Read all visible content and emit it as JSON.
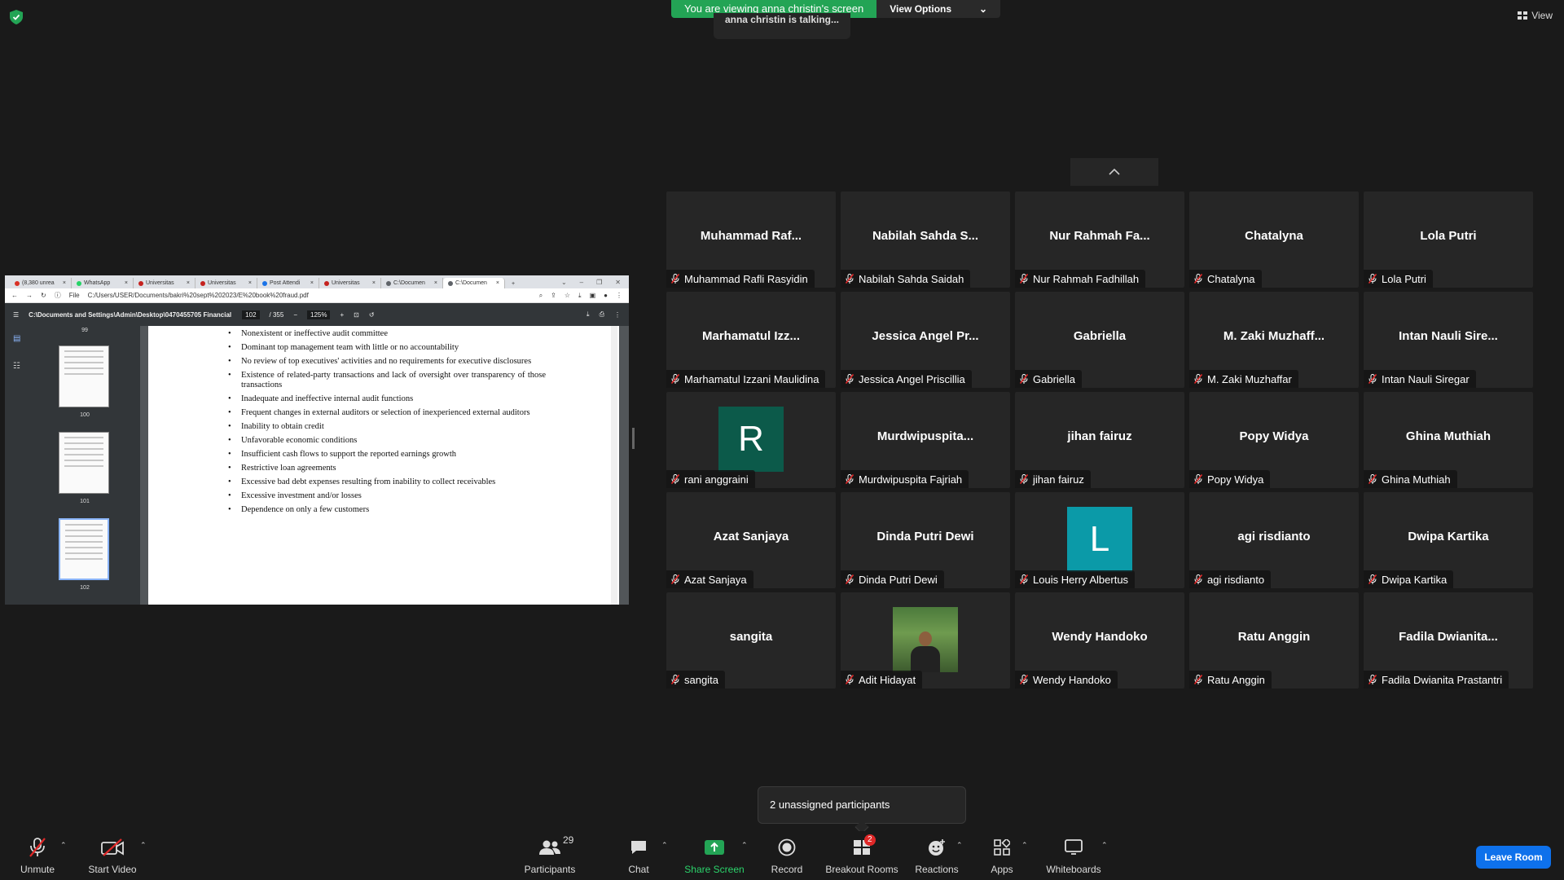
{
  "banner": {
    "viewing_text": "You are viewing anna christin's screen",
    "view_options": "View Options",
    "talking": "anna christin is talking..."
  },
  "top_right_view": "View",
  "browser": {
    "tabs": [
      {
        "label": "(8,380 unrea",
        "color": "#d93025"
      },
      {
        "label": "WhatsApp",
        "color": "#25d366"
      },
      {
        "label": "Universitas",
        "color": "#c5221f"
      },
      {
        "label": "Universitas",
        "color": "#c5221f"
      },
      {
        "label": "Post Attendi",
        "color": "#1a73e8"
      },
      {
        "label": "Universitas",
        "color": "#c5221f"
      },
      {
        "label": "C:\\Documen",
        "color": "#5f6368"
      },
      {
        "label": "C:\\Documen",
        "color": "#5f6368"
      }
    ],
    "new_tab": "+",
    "url_prefix": "File",
    "url": "C:/Users/USER/Documents/bakri%20sept%202023/E%20book%20fraud.pdf"
  },
  "pdf": {
    "title": "C:\\Documents and Settings\\Admin\\Desktop\\0470455705 Financial S...",
    "page_current": "102",
    "page_total": "/ 355",
    "zoom": "125%",
    "thumbnails": [
      "99",
      "100",
      "101",
      "102"
    ],
    "bullets": [
      "Nonexistent or ineffective audit committee",
      "Dominant top management team with little or no accountability",
      "No review of top executives' activities and no requirements for executive disclosures",
      "Existence of related-party transactions and lack of oversight over transparency of those transactions",
      "Inadequate and ineffective internal audit functions",
      "Frequent changes in external auditors or selection of inexperienced external auditors",
      "Inability to obtain credit",
      "Unfavorable economic conditions",
      "Insufficient cash flows to support the reported earnings growth",
      "Restrictive loan agreements",
      "Excessive bad debt expenses resulting from inability to collect receivables",
      "Excessive investment and/or losses",
      "Dependence on only a few customers"
    ]
  },
  "participants": [
    {
      "display": "Muhammad  Raf...",
      "name": "Muhammad Rafli Rasyidin"
    },
    {
      "display": "Nabilah  Sahda  S...",
      "name": "Nabilah Sahda Saidah"
    },
    {
      "display": "Nur  Rahmah  Fa...",
      "name": "Nur Rahmah Fadhillah"
    },
    {
      "display": "Chatalyna",
      "name": "Chatalyna"
    },
    {
      "display": "Lola Putri",
      "name": "Lola Putri"
    },
    {
      "display": "Marhamatul  Izz...",
      "name": "Marhamatul Izzani Maulidina"
    },
    {
      "display": "Jessica  Angel  Pr...",
      "name": "Jessica Angel Priscillia"
    },
    {
      "display": "Gabriella",
      "name": "Gabriella"
    },
    {
      "display": "M.  Zaki  Muzhaff...",
      "name": "M. Zaki Muzhaffar"
    },
    {
      "display": "Intan  Nauli  Sire...",
      "name": "Intan Nauli Siregar"
    },
    {
      "display": "R",
      "name": "rani anggraini",
      "avatar_color": "#0c5a4a"
    },
    {
      "display": "Murdwipuspita...",
      "name": "Murdwipuspita Fajriah"
    },
    {
      "display": "jihan fairuz",
      "name": "jihan fairuz"
    },
    {
      "display": "Popy Widya",
      "name": "Popy Widya"
    },
    {
      "display": "Ghina Muthiah",
      "name": "Ghina Muthiah"
    },
    {
      "display": "Azat Sanjaya",
      "name": "Azat Sanjaya"
    },
    {
      "display": "Dinda Putri Dewi",
      "name": "Dinda Putri Dewi"
    },
    {
      "display": "L",
      "name": "Louis Herry Albertus",
      "avatar_color": "#0b9aa8"
    },
    {
      "display": "agi risdianto",
      "name": "agi risdianto"
    },
    {
      "display": "Dwipa Kartika",
      "name": "Dwipa Kartika"
    },
    {
      "display": "sangita",
      "name": "sangita"
    },
    {
      "display": "",
      "name": "Adit Hidayat",
      "photo": true
    },
    {
      "display": "Wendy Handoko",
      "name": "Wendy Handoko"
    },
    {
      "display": "Ratu Anggin",
      "name": "Ratu Anggin"
    },
    {
      "display": "Fadila  Dwianita...",
      "name": "Fadila Dwianita Prastantri"
    }
  ],
  "popup": "2 unassigned participants",
  "toolbar": {
    "unmute": "Unmute",
    "start_video": "Start Video",
    "participants": "Participants",
    "participants_count": "29",
    "chat": "Chat",
    "share_screen": "Share Screen",
    "record": "Record",
    "breakout_rooms": "Breakout Rooms",
    "breakout_badge": "2",
    "reactions": "Reactions",
    "apps": "Apps",
    "whiteboards": "Whiteboards",
    "leave": "Leave Room"
  },
  "colors": {
    "accent_green": "#23a455",
    "leave_blue": "#0e71eb",
    "muted_red": "#e02828"
  }
}
